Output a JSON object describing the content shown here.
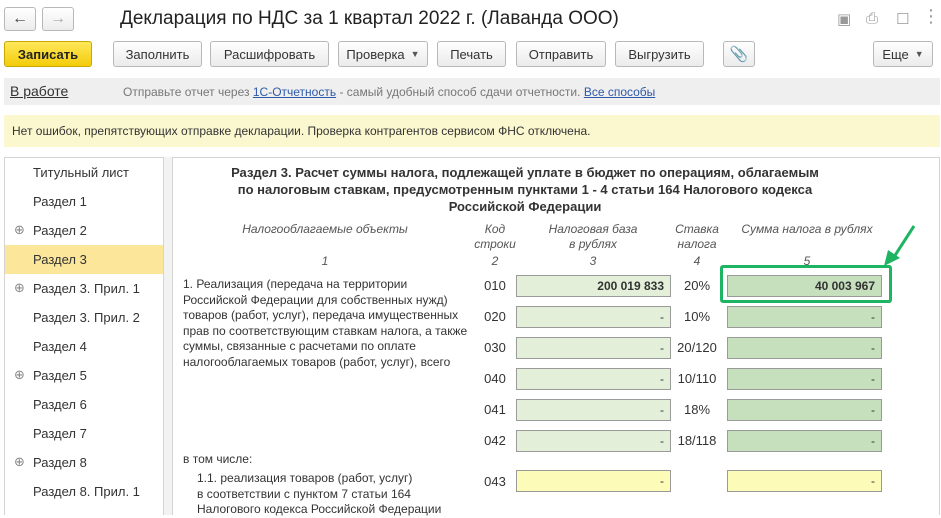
{
  "window": {
    "title": "Декларация по НДС за 1 квартал 2022 г. (Лаванда ООО)",
    "back_icon": "arrow-left-icon",
    "forward_icon": "arrow-right-icon"
  },
  "toolbar": {
    "save": "Записать",
    "fill": "Заполнить",
    "decode": "Расшифровать",
    "check": "Проверка",
    "print": "Печать",
    "send": "Отправить",
    "export": "Выгрузить",
    "more": "Еще"
  },
  "status": {
    "state": "В работе",
    "hint_prefix": "Отправьте отчет через",
    "hint_link1": "1С-Отчетность",
    "hint_middle": "- самый удобный способ сдачи отчетности.",
    "hint_link2": "Все способы"
  },
  "info": "Нет ошибок, препятствующих отправке декларации. Проверка контрагентов сервисом ФНС отключена.",
  "nav": {
    "items": [
      {
        "label": "Титульный лист",
        "expandable": false
      },
      {
        "label": "Раздел 1",
        "expandable": false
      },
      {
        "label": "Раздел 2",
        "expandable": true
      },
      {
        "label": "Раздел 3",
        "expandable": false,
        "selected": true
      },
      {
        "label": "Раздел 3. Прил. 1",
        "expandable": true
      },
      {
        "label": "Раздел 3. Прил. 2",
        "expandable": false
      },
      {
        "label": "Раздел 4",
        "expandable": false
      },
      {
        "label": "Раздел 5",
        "expandable": true
      },
      {
        "label": "Раздел 6",
        "expandable": false
      },
      {
        "label": "Раздел 7",
        "expandable": false
      },
      {
        "label": "Раздел 8",
        "expandable": true
      },
      {
        "label": "Раздел 8. Прил. 1",
        "expandable": false
      }
    ]
  },
  "section": {
    "title_line1": "Раздел 3. Расчет суммы налога, подлежащей уплате в бюджет по операциям, облагаемым",
    "title_line2": "по налоговым ставкам, предусмотренным пунктами 1 - 4 статьи 164 Налогового кодекса",
    "title_line3": "Российской Федерации",
    "col1_header": "Налогооблагаемые объекты",
    "col2_header_l1": "Код",
    "col2_header_l2": "строки",
    "col3_header_l1": "Налоговая база",
    "col3_header_l2": "в рублях",
    "col4_header_l1": "Ставка",
    "col4_header_l2": "налога",
    "col5_header": "Сумма налога в рублях",
    "col_nums": [
      "1",
      "2",
      "3",
      "4",
      "5"
    ],
    "item1_lines": [
      "1. Реализация (передача на территории",
      "Российской Федерации для собственных нужд)",
      "товаров (работ, услуг), передача имущественных",
      "прав по соответствующим ставкам налога, а также",
      "суммы, связанные с расчетами по оплате",
      "налогооблагаемых товаров (работ, услуг), всего"
    ],
    "rows": [
      {
        "code": "010",
        "base": "200 019 833",
        "rate": "20%",
        "tax": "40 003 967"
      },
      {
        "code": "020",
        "base": "-",
        "rate": "10%",
        "tax": "-"
      },
      {
        "code": "030",
        "base": "-",
        "rate": "20/120",
        "tax": "-"
      },
      {
        "code": "040",
        "base": "-",
        "rate": "10/110",
        "tax": "-"
      },
      {
        "code": "041",
        "base": "-",
        "rate": "18%",
        "tax": "-"
      },
      {
        "code": "042",
        "base": "-",
        "rate": "18/118",
        "tax": "-"
      }
    ],
    "including": "в том числе:",
    "sub1_lines": [
      "1.1. реализация товаров (работ, услуг)",
      "в соответствии с пунктом 7 статьи 164",
      "Налогового кодекса Российской Федерации"
    ],
    "sub1_code": "043",
    "sub1_base": "-",
    "sub1_tax": "-"
  },
  "colors": {
    "accent_yellow": "#f3cc0a",
    "highlight_green": "#1db462",
    "field_green": "#e3efd9"
  }
}
